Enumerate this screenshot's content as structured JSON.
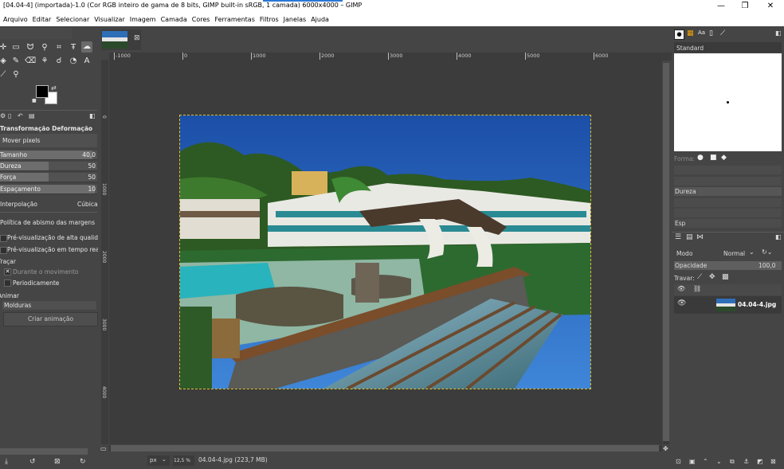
{
  "window": {
    "title": "[04.04-4] (importada)-1.0 (Cor RGB inteiro de gama de 8 bits, GIMP built-in sRGB, 1 camada) 6000x4000 – GIMP",
    "controls": {
      "minimize": "—",
      "restore": "❐",
      "close": "✕"
    }
  },
  "menu": [
    "Arquivo",
    "Editar",
    "Selecionar",
    "Visualizar",
    "Imagem",
    "Camada",
    "Cores",
    "Ferramentas",
    "Filtros",
    "Janelas",
    "Ajuda"
  ],
  "tool_options": {
    "title": "Transformação Deformação",
    "mode": "Mover pixels",
    "sliders": [
      {
        "label": "Tamanho",
        "value": "40,0",
        "fraction": 0.95
      },
      {
        "label": "Dureza",
        "value": "50",
        "fraction": 0.5
      },
      {
        "label": "Força",
        "value": "50",
        "fraction": 0.5
      },
      {
        "label": "Espaçamento",
        "value": "10",
        "fraction": 0.98
      }
    ],
    "interpolation_label": "Interpolação",
    "interpolation_value": "Cúbica",
    "abyss_policy": "Política de abismo das margens",
    "hq_preview": "Pré-visualização de alta qualidade",
    "realtime_preview": "Pré-visualização em tempo real",
    "stroke_section": "Traçar",
    "during_motion": "Durante o movimento",
    "periodically": "Periodicamente",
    "animate_section": "Animar",
    "frames": "Molduras",
    "create_animation": "Criar animação"
  },
  "ruler": {
    "top": [
      "-1000",
      "0",
      "1000",
      "2000",
      "3000",
      "4000",
      "5000",
      "6000"
    ],
    "left": [
      "0",
      "1000",
      "2000",
      "3000",
      "4000"
    ]
  },
  "statusbar": {
    "unit": "px",
    "zoom": "12,5 %",
    "file": "04.04-4.jpg (223,7 MB)"
  },
  "brushes": {
    "name": "Standard",
    "forma": "Forma:",
    "dureza": "Dureza",
    "esp": "Esp"
  },
  "layers": {
    "mode_label": "Modo",
    "mode_value": "Normal",
    "opacity_label": "Opacidade",
    "opacity_value": "100,0",
    "lock_label": "Travar:",
    "layer_name": "04.04-4.jpg"
  },
  "colors": {
    "accent": "#2b78d6",
    "fg": "#000000",
    "bg": "#ffffff",
    "selection": "#d6c23a"
  }
}
